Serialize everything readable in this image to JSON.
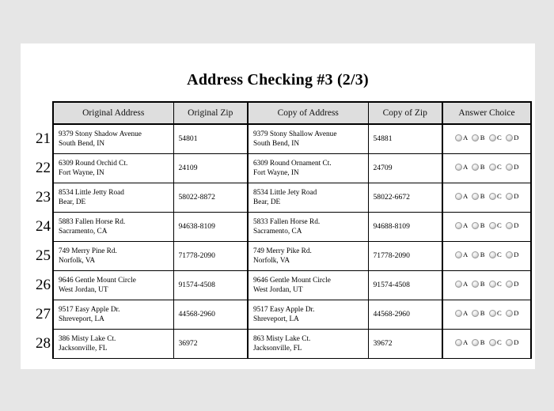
{
  "page": {
    "title": "Address Checking #3 (2/3)",
    "background_color": "#e6e6e6",
    "sheet_color": "#ffffff"
  },
  "table": {
    "header_bg": "#dedede",
    "columns": [
      "Original Address",
      "Original Zip",
      "Copy of Address",
      "Copy of Zip",
      "Answer Choice"
    ],
    "answer_options": [
      "A",
      "B",
      "C",
      "D"
    ],
    "rows": [
      {
        "number": "21",
        "original_address_line1": "9379 Stony Shadow Avenue",
        "original_address_line2": "South Bend, IN",
        "original_zip": "54801",
        "copy_address_line1": "9379 Stony Shallow Avenue",
        "copy_address_line2": "South Bend, IN",
        "copy_zip": "54881"
      },
      {
        "number": "22",
        "original_address_line1": "6309 Round Orchid Ct.",
        "original_address_line2": "Fort Wayne, IN",
        "original_zip": "24109",
        "copy_address_line1": "6309 Round Ornament Ct.",
        "copy_address_line2": "Fort Wayne, IN",
        "copy_zip": "24709"
      },
      {
        "number": "23",
        "original_address_line1": "8534 Little Jetty Road",
        "original_address_line2": "Bear, DE",
        "original_zip": "58022-8872",
        "copy_address_line1": "8534 Little Jety Road",
        "copy_address_line2": "Bear, DE",
        "copy_zip": "58022-6672"
      },
      {
        "number": "24",
        "original_address_line1": "5883 Fallen Horse Rd.",
        "original_address_line2": "Sacramento, CA",
        "original_zip": "94638-8109",
        "copy_address_line1": "5833 Fallen Horse Rd.",
        "copy_address_line2": "Sacramento, CA",
        "copy_zip": "94688-8109"
      },
      {
        "number": "25",
        "original_address_line1": "749 Merry Pine Rd.",
        "original_address_line2": "Norfolk, VA",
        "original_zip": "71778-2090",
        "copy_address_line1": "749 Merry Pike Rd.",
        "copy_address_line2": "Norfolk, VA",
        "copy_zip": "71778-2090"
      },
      {
        "number": "26",
        "original_address_line1": "9646 Gentle Mount Circle",
        "original_address_line2": "West Jordan, UT",
        "original_zip": "91574-4508",
        "copy_address_line1": "9646 Gentle Mount Circle",
        "copy_address_line2": "West Jordan, UT",
        "copy_zip": "91574-4508"
      },
      {
        "number": "27",
        "original_address_line1": "9517 Easy Apple Dr.",
        "original_address_line2": "Shreveport, LA",
        "original_zip": "44568-2960",
        "copy_address_line1": "9517 Easy Apple Dr.",
        "copy_address_line2": "Shreveport, LA",
        "copy_zip": "44568-2960"
      },
      {
        "number": "28",
        "original_address_line1": "386 Misty Lake Ct.",
        "original_address_line2": "Jacksonville, FL",
        "original_zip": "36972",
        "copy_address_line1": "863 Misty Lake Ct.",
        "copy_address_line2": "Jacksonville, FL",
        "copy_zip": "39672"
      }
    ]
  }
}
